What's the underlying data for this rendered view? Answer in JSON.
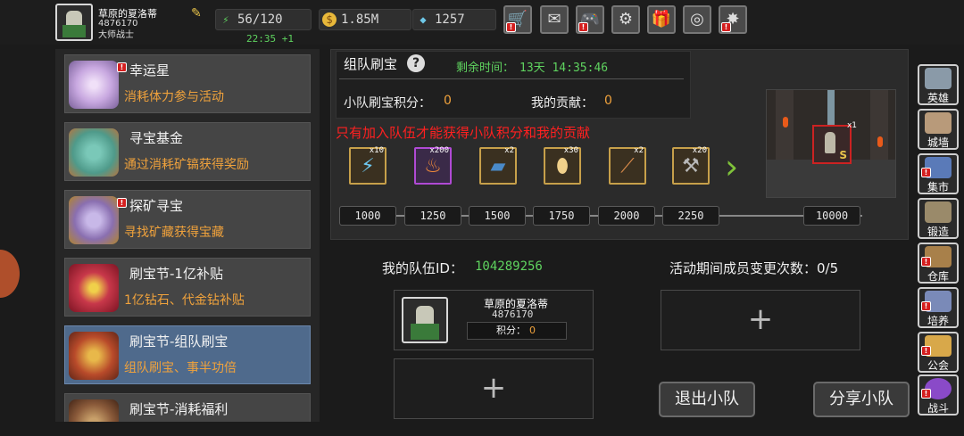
{
  "player": {
    "name": "草原的夏洛蒂",
    "id": "4876170",
    "rank": "大师战士"
  },
  "resources": {
    "stamina": "56/120",
    "stamina_regen": "22:35 +1",
    "gold": "1.85M",
    "diamond": "1257"
  },
  "top_icons": [
    "cart-icon",
    "mail-icon",
    "gamepad-icon",
    "gear-icon",
    "gift-icon",
    "wheel-icon",
    "firework-icon"
  ],
  "sidebar": {
    "items": [
      {
        "title": "幸运星",
        "desc": "消耗体力参与活动",
        "color": "#c8a8e0"
      },
      {
        "title": "寻宝基金",
        "desc": "通过消耗矿镐获得奖励",
        "color": "#4f9a8a"
      },
      {
        "title": "探矿寻宝",
        "desc": "寻找矿藏获得宝藏",
        "color": "#8a6fb0"
      },
      {
        "title": "刷宝节-1亿补贴",
        "desc": "1亿钻石、代金钻补贴",
        "color": "#c8384a"
      },
      {
        "title": "刷宝节-组队刷宝",
        "desc": "组队刷宝、事半功倍",
        "color": "#b84a2a"
      },
      {
        "title": "刷宝节-消耗福利",
        "desc": "",
        "color": "#8a5a3a"
      }
    ]
  },
  "event": {
    "title": "组队刷宝",
    "time_label": "剩余时间：",
    "time_value": "13天 14:35:46",
    "team_score_label": "小队刷宝积分：",
    "team_score": "0",
    "my_contrib_label": "我的贡献：",
    "my_contrib": "0",
    "warning": "只有加入队伍才能获得小队积分和我的贡献",
    "rewards": [
      {
        "icon": "lightning-icon",
        "count": "x10"
      },
      {
        "icon": "fire-scroll-icon",
        "count": "x200"
      },
      {
        "icon": "book-icon",
        "count": "x2"
      },
      {
        "icon": "egg-icon",
        "count": "x30"
      },
      {
        "icon": "scroll-icon",
        "count": "x2"
      },
      {
        "icon": "hammer-icon",
        "count": "x20"
      }
    ],
    "milestones": [
      "1000",
      "1250",
      "1500",
      "1750",
      "2000",
      "2250",
      "10000"
    ],
    "boss_count": "x1",
    "boss_grade": "S"
  },
  "team": {
    "id_label": "我的队伍ID：",
    "id_value": "104289256",
    "changes_label": "活动期间成员变更次数：",
    "changes_value": "0/5",
    "member": {
      "name": "草原的夏洛蒂",
      "id": "4876170",
      "score_label": "积分：",
      "score": "0"
    },
    "plus": "+",
    "quit_label": "退出小队",
    "share_label": "分享小队"
  },
  "right_menu": [
    {
      "label": "英雄",
      "color": "#8a9aa8"
    },
    {
      "label": "城墙",
      "color": "#b89a7a"
    },
    {
      "label": "集市",
      "color": "#5a7ab8"
    },
    {
      "label": "锻造",
      "color": "#9a8a6a"
    },
    {
      "label": "仓库",
      "color": "#a8804a"
    },
    {
      "label": "培养",
      "color": "#7a8ab8"
    },
    {
      "label": "公会",
      "color": "#d8a84a"
    },
    {
      "label": "战斗",
      "color": "#8a4ac8"
    }
  ]
}
